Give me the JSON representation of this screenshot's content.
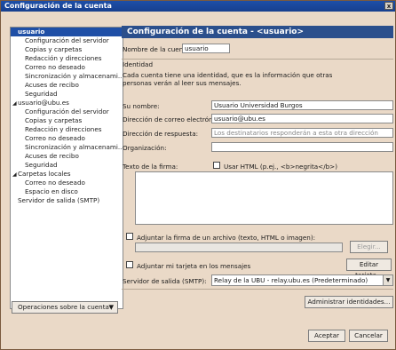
{
  "window": {
    "title": "Configuración de la cuenta",
    "close_glyph": "x"
  },
  "sidebar": {
    "items": [
      {
        "label": "usuario",
        "level": 0,
        "selected": true,
        "twisty": ""
      },
      {
        "label": "Configuración del servidor",
        "level": 1
      },
      {
        "label": "Copias y carpetas",
        "level": 1
      },
      {
        "label": "Redacción y direcciones",
        "level": 1
      },
      {
        "label": "Correo no deseado",
        "level": 1
      },
      {
        "label": "Sincronización y almacenami...",
        "level": 1
      },
      {
        "label": "Acuses de recibo",
        "level": 1
      },
      {
        "label": "Seguridad",
        "level": 1
      },
      {
        "label": "usuario@ubu.es",
        "level": 0,
        "twisty": "◢"
      },
      {
        "label": "Configuración del servidor",
        "level": 1
      },
      {
        "label": "Copias y carpetas",
        "level": 1
      },
      {
        "label": "Redacción y direcciones",
        "level": 1
      },
      {
        "label": "Correo no deseado",
        "level": 1
      },
      {
        "label": "Sincronización y almacenami...",
        "level": 1
      },
      {
        "label": "Acuses de recibo",
        "level": 1
      },
      {
        "label": "Seguridad",
        "level": 1
      },
      {
        "label": "Carpetas locales",
        "level": 0,
        "twisty": "◢"
      },
      {
        "label": "Correo no deseado",
        "level": 1
      },
      {
        "label": "Espacio en disco",
        "level": 1
      },
      {
        "label": "Servidor de salida (SMTP)",
        "level": 0,
        "twisty": ""
      }
    ],
    "operations_button": "Operaciones sobre la cuenta",
    "operations_arrow": "▼"
  },
  "main": {
    "header": "Configuración de la cuenta - <usuario>",
    "account_name_label": "Nombre de la cuenta:",
    "account_name_value": "usuario",
    "identity_title": "Identidad",
    "identity_desc": "Cada cuenta tiene una identidad, que es la información que otras personas verán al leer sus mensajes.",
    "name_label": "Su nombre:",
    "name_value": "Usuario Universidad Burgos",
    "email_label": "Dirección de correo electrónico:",
    "email_value": "usuario@ubu.es",
    "reply_label": "Dirección de respuesta:",
    "reply_placeholder": "Los destinatarios responderán a esta otra dirección",
    "org_label": "Organización:",
    "org_value": "",
    "signature_label": "Texto de la firma:",
    "use_html_label": "Usar HTML (p.ej., <b>negrita</b>)",
    "attach_signature_label": "Adjuntar la firma de un archivo (texto, HTML o imagen):",
    "choose_button": "Elegir...",
    "attach_vcard_label": "Adjuntar mi tarjeta en los mensajes",
    "edit_card_button": "Editar tarjeta...",
    "smtp_label": "Servidor de salida (SMTP):",
    "smtp_value": "Relay de la UBU - relay.ubu.es (Predeterminado)",
    "dropdown_glyph": "▼",
    "manage_identities_button": "Administrar identidades...",
    "accept_button": "Aceptar",
    "cancel_button": "Cancelar"
  },
  "colors": {
    "header": "#2b4f8c",
    "selected": "#1f4fa6",
    "window_bg": "#ead9c7",
    "desktop_bg": "#f4c8a0"
  }
}
